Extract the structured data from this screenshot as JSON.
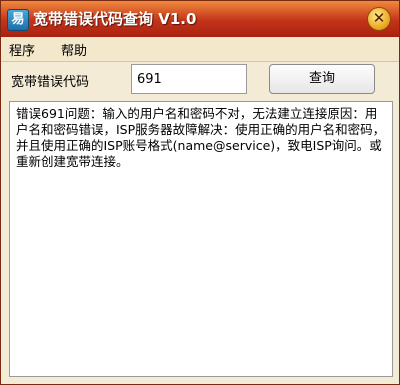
{
  "window": {
    "title": "宽带错误代码查询 V1.0",
    "icon_name": "broadband-app-icon",
    "app_icon_glyph": "易",
    "close_glyph": "✕"
  },
  "menu": {
    "items": [
      {
        "label": "程序"
      },
      {
        "label": "帮助"
      }
    ]
  },
  "query": {
    "label": "宽带错误代码",
    "input_value": "691",
    "button_label": "查询"
  },
  "result": {
    "text": "错误691问题：输入的用户名和密码不对，无法建立连接原因：用户名和密码错误，ISP服务器故障解决：使用正确的用户名和密码，并且使用正确的ISP账号格式(name@service)，致电ISP询问。或重新创建宽带连接。"
  },
  "colors": {
    "titlebar": "#c3331a",
    "body_background": "#f4ebd6",
    "close_button": "#e9a21a"
  }
}
